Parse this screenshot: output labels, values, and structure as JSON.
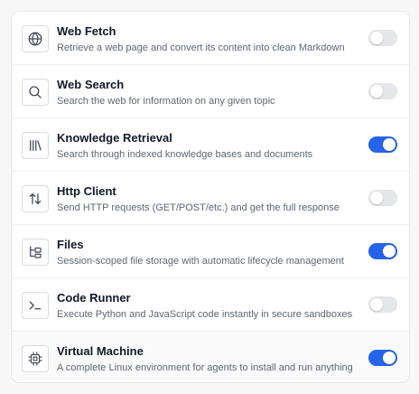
{
  "colors": {
    "accent": "#2563eb",
    "toggle_off": "#e5e7eb"
  },
  "tools": [
    {
      "icon": "globe-icon",
      "title": "Web Fetch",
      "description": "Retrieve a web page and convert its content into clean Markdown",
      "enabled": false
    },
    {
      "icon": "search-icon",
      "title": "Web Search",
      "description": "Search the web for information on any given topic",
      "enabled": false
    },
    {
      "icon": "library-icon",
      "title": "Knowledge Retrieval",
      "description": "Search through indexed knowledge bases and documents",
      "enabled": true
    },
    {
      "icon": "arrows-up-down-icon",
      "title": "Http Client",
      "description": "Send HTTP requests (GET/POST/etc.) and get the full response",
      "enabled": false
    },
    {
      "icon": "folder-tree-icon",
      "title": "Files",
      "description": "Session-scoped file storage with automatic lifecycle management",
      "enabled": true
    },
    {
      "icon": "terminal-icon",
      "title": "Code Runner",
      "description": "Execute Python and JavaScript code instantly in secure sandboxes",
      "enabled": false
    },
    {
      "icon": "cpu-chip-icon",
      "title": "Virtual Machine",
      "description": "A complete Linux environment for agents to install and run anything",
      "enabled": true
    }
  ]
}
